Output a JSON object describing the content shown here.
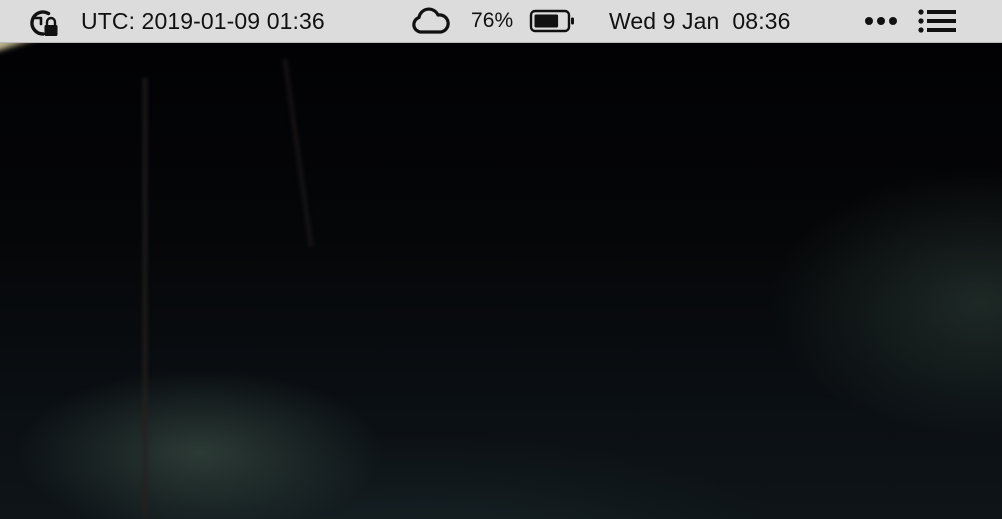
{
  "menubar": {
    "lock_icon": "time-machine-lock-icon",
    "utc_clock": "UTC: 2019-01-09 01:36",
    "cloud_icon": "cloud-icon",
    "battery_percent": "76%",
    "battery_level": 0.76,
    "battery_icon": "battery-icon",
    "local_clock": "Wed 9 Jan  08:36",
    "more_icon": "ellipsis-icon",
    "list_icon": "notification-center-icon"
  },
  "colors": {
    "menubar_bg": "#dcdcdc",
    "menubar_text": "#111111",
    "desktop_bg": "#050608"
  }
}
